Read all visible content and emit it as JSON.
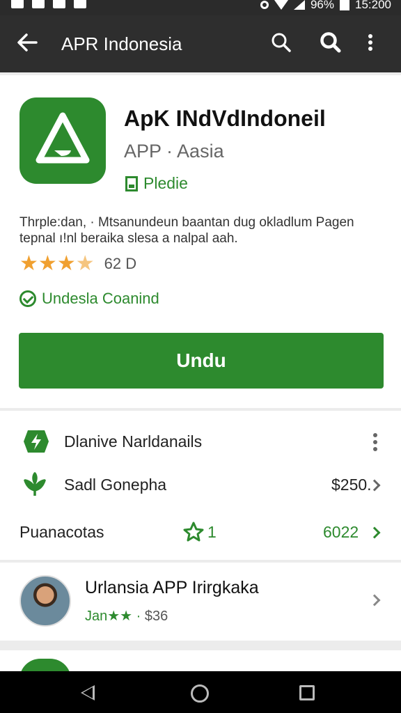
{
  "status_bar": {
    "battery": "96%",
    "time": "15:200"
  },
  "app_bar": {
    "title": "APR Indonesia"
  },
  "app": {
    "name": "ApK INdVdIndoneil",
    "developer": "APP · Aasia",
    "badge": "Pledie",
    "description": "Thrple:dan, · Mtsanundeun baantan dug okladlum Pagen tepnal ı!nl beraika slesa a nalpal aah.",
    "rating_stars": 3.5,
    "rating_count": "62 D",
    "verified": "Undesla Coanind",
    "install_label": "Undu"
  },
  "details": {
    "header": "Dlanive Narldanails",
    "row2_label": "Sadl Gonepha",
    "row2_value": "$250.",
    "row3_label": "Puanacotas",
    "row3_mid": "1",
    "row3_value": "6022"
  },
  "related": {
    "name": "Urlansia APP Irirgkaka",
    "sub_green": "Jan★★ ·",
    "sub_price": "$36"
  },
  "colors": {
    "accent": "#2d8a2e",
    "star": "#f0a030",
    "appbar": "#2e2e2e"
  }
}
